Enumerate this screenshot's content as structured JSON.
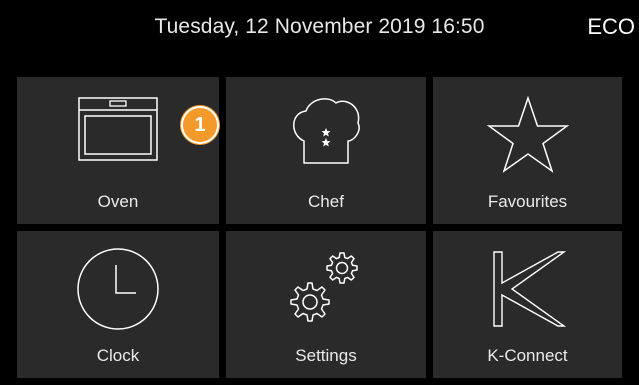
{
  "status_bar": {
    "datetime": "Tuesday, 12 November 2019 16:50",
    "mode": "ECO"
  },
  "tiles": [
    {
      "label": "Oven",
      "icon": "oven-icon",
      "badge": "1"
    },
    {
      "label": "Chef",
      "icon": "chef-hat-icon"
    },
    {
      "label": "Favourites",
      "icon": "star-icon"
    },
    {
      "label": "Clock",
      "icon": "clock-icon"
    },
    {
      "label": "Settings",
      "icon": "gears-icon"
    },
    {
      "label": "K-Connect",
      "icon": "k-connect-icon"
    }
  ],
  "colors": {
    "background": "#000000",
    "tile": "#2a2a2a",
    "badge": "#f39a2a",
    "text": "#ffffff"
  }
}
